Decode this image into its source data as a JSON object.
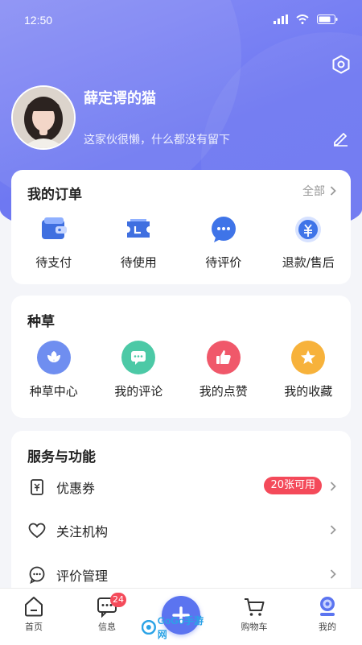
{
  "status_bar": {
    "time": "12:50"
  },
  "profile": {
    "username": "薛定谔的猫",
    "bio": "这家伙很懒，什么都没有留下"
  },
  "orders": {
    "title": "我的订单",
    "more_label": "全部",
    "items": [
      {
        "label": "待支付",
        "icon": "wallet-icon"
      },
      {
        "label": "待使用",
        "icon": "ticket-icon"
      },
      {
        "label": "待评价",
        "icon": "chat-bubble-icon"
      },
      {
        "label": "退款/售后",
        "icon": "refund-yen-icon"
      }
    ]
  },
  "grass": {
    "title": "种草",
    "items": [
      {
        "label": "种草中心",
        "icon": "flower-icon",
        "color": "#6f8ef0"
      },
      {
        "label": "我的评论",
        "icon": "comment-icon",
        "color": "#4cc9a6"
      },
      {
        "label": "我的点赞",
        "icon": "thumbs-up-icon",
        "color": "#f0586a"
      },
      {
        "label": "我的收藏",
        "icon": "star-icon",
        "color": "#f7b23b"
      }
    ]
  },
  "services": {
    "title": "服务与功能",
    "items": [
      {
        "label": "优惠券",
        "icon": "coupon-icon",
        "badge": "20张可用"
      },
      {
        "label": "关注机构",
        "icon": "heart-icon"
      },
      {
        "label": "评价管理",
        "icon": "comment-outline-icon"
      }
    ]
  },
  "tabbar": {
    "items": [
      {
        "label": "首页",
        "icon": "home-icon"
      },
      {
        "label": "信息",
        "icon": "message-icon",
        "badge": "24"
      },
      {
        "label": "购物车",
        "icon": "cart-icon"
      },
      {
        "label": "我的",
        "icon": "profile-icon"
      }
    ],
    "fab_icon": "plus-icon"
  },
  "watermark": {
    "text": "GoGo手游网"
  },
  "colors": {
    "header_gradient_start": "#8a8ff5",
    "header_gradient_end": "#6c76f1",
    "accent": "#5b74f0",
    "badge_red": "#f44a5a"
  }
}
